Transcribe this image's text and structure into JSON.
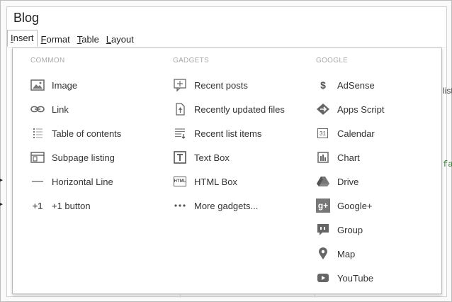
{
  "page": {
    "title": "Blog",
    "right_fragment_1": "list",
    "right_fragment_2": "fau"
  },
  "menubar": {
    "items": [
      {
        "key": "I",
        "rest": "nsert",
        "active": true
      },
      {
        "key": "F",
        "rest": "ormat",
        "active": false
      },
      {
        "key": "T",
        "rest": "able",
        "active": false
      },
      {
        "key": "L",
        "rest": "ayout",
        "active": false
      }
    ]
  },
  "insert_menu": {
    "common": {
      "heading": "COMMON",
      "items": [
        {
          "label": "Image",
          "icon": "image-icon"
        },
        {
          "label": "Link",
          "icon": "link-icon"
        },
        {
          "label": "Table of contents",
          "icon": "table-of-contents-icon"
        },
        {
          "label": "Subpage listing",
          "icon": "subpage-listing-icon"
        },
        {
          "label": "Horizontal Line",
          "icon": "horizontal-line-icon"
        },
        {
          "label": "+1 button",
          "icon": "plus-one-icon",
          "icon_text": "+1"
        }
      ]
    },
    "gadgets": {
      "heading": "GADGETS",
      "items": [
        {
          "label": "Recent posts",
          "icon": "recent-posts-icon"
        },
        {
          "label": "Recently updated files",
          "icon": "recently-updated-files-icon"
        },
        {
          "label": "Recent list items",
          "icon": "recent-list-items-icon"
        },
        {
          "label": "Text Box",
          "icon": "text-box-icon"
        },
        {
          "label": "HTML Box",
          "icon": "html-box-icon",
          "icon_text": "HTML"
        },
        {
          "label": "More gadgets...",
          "icon": "more-gadgets-icon"
        }
      ]
    },
    "google": {
      "heading": "GOOGLE",
      "items": [
        {
          "label": "AdSense",
          "icon": "adsense-icon",
          "icon_text": "$"
        },
        {
          "label": "Apps Script",
          "icon": "apps-script-icon"
        },
        {
          "label": "Calendar",
          "icon": "calendar-icon",
          "icon_text": "31"
        },
        {
          "label": "Chart",
          "icon": "chart-icon"
        },
        {
          "label": "Drive",
          "icon": "drive-icon",
          "submenu": true
        },
        {
          "label": "Google+",
          "icon": "google-plus-icon",
          "icon_text": "g+",
          "submenu": true
        },
        {
          "label": "Group",
          "icon": "group-icon"
        },
        {
          "label": "Map",
          "icon": "map-icon"
        },
        {
          "label": "YouTube",
          "icon": "youtube-icon"
        }
      ]
    },
    "submenu_arrow": "▶"
  }
}
